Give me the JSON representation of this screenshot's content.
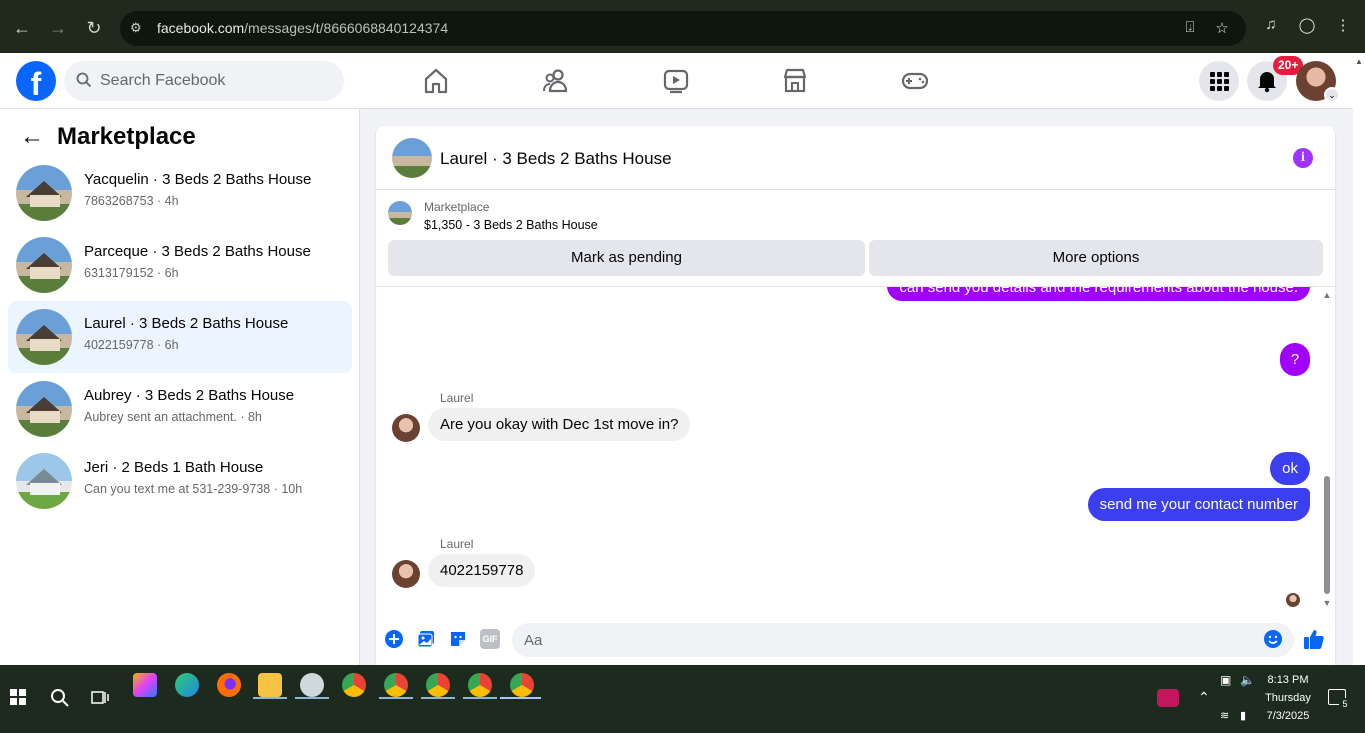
{
  "browser": {
    "url_domain": "facebook.com",
    "url_path": "/messages/t/8666068840124374"
  },
  "header": {
    "logo": "f",
    "search_placeholder": "Search Facebook",
    "notification_badge": "20+",
    "nav_icons": [
      "home-icon",
      "friends-icon",
      "video-icon",
      "marketplace-icon",
      "gaming-icon"
    ]
  },
  "sidebar": {
    "title": "Marketplace",
    "conversations": [
      {
        "name": "Yacquelin · 3 Beds 2 Baths House",
        "sub": "7863268753 · 4h",
        "active": false
      },
      {
        "name": "Parceque · 3 Beds 2 Baths House",
        "sub": "6313179152 · 6h",
        "active": false
      },
      {
        "name": "Laurel · 3 Beds 2 Baths House",
        "sub": "4022159778 · 6h",
        "active": true
      },
      {
        "name": "Aubrey · 3 Beds 2 Baths House",
        "sub": "Aubrey sent an attachment. · 8h",
        "active": false
      },
      {
        "name": "Jeri · 2 Beds 1 Bath House",
        "sub": "Can you text me at 531-239-9738 · 10h",
        "active": false
      }
    ]
  },
  "chat": {
    "title": "Laurel · 3 Beds 2 Baths House",
    "marketplace_label": "Marketplace",
    "listing": "$1,350 - 3 Beds 2 Baths House",
    "mark_pending": "Mark as pending",
    "more_options": "More options",
    "messages": {
      "partial_out": "can send you details and the requirements about the house.",
      "q_out": "?",
      "sender1": "Laurel",
      "in1": "Are you okay with Dec 1st move in?",
      "out_ok": "ok",
      "out_contact": "send me your contact number",
      "sender2": "Laurel",
      "in2": "4022159778"
    },
    "composer_placeholder": "Aa",
    "gif_label": "GIF"
  },
  "taskbar": {
    "time": "8:13 PM",
    "day": "Thursday",
    "date": "7/3/2025",
    "notifications": "5"
  },
  "colors": {
    "fb_blue": "#0866ff",
    "purple_bubble": "#a000ff",
    "blue_bubble": "#3b3ff0"
  }
}
